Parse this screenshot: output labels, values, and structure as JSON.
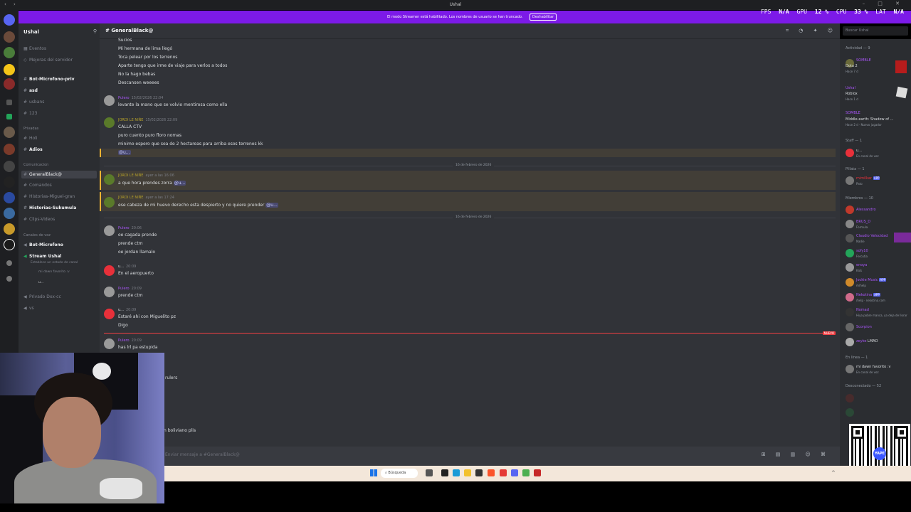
{
  "window": {
    "title": "Ushal"
  },
  "banner": {
    "message": "El modo Streamer está habilitado. Los nombres de usuario se han truncado.",
    "button": "Deshabilitar"
  },
  "perf": {
    "fps_label": "FPS",
    "fps": "N/A",
    "gpu_label": "GPU",
    "gpu": "12 %",
    "cpu_label": "CPU",
    "cpu": "33 %",
    "lat_label": "LAT",
    "lat": "N/A"
  },
  "server": {
    "name": "Ushal"
  },
  "sidebar": {
    "top": [
      "Eventos",
      "Mejoras del servidor"
    ],
    "channels_a": [
      "Bot-Microfono-priv",
      "asd",
      "usbans",
      "123"
    ],
    "cat_privadas": "Privadas",
    "privadas": [
      "Holi",
      "Adios"
    ],
    "cat_comunicacion": "Comunicacion",
    "comunicacion": [
      "GeneralBlack@",
      "Comandos",
      "Historias-Miguel-gran",
      "Historias-Sukumula",
      "Clips-Videos"
    ],
    "cat_voz": "Canales de voz",
    "voz": [
      "Bot-Microfono",
      "Stream Ushal"
    ],
    "voz_status": "Establece un estado de canal",
    "voz_users": [
      "mi dawn favorito :v",
      "u..."
    ],
    "extra": [
      "Privado Dxx-cc",
      "vs"
    ]
  },
  "chat": {
    "channel": "GeneralBlack@",
    "composer_placeholder": "Enviar mensaje a #GeneralBlack@",
    "top_lines": [
      "Sucios",
      "Mi hermana de lima llegó",
      "Toca pelear por los terrenos",
      "Aparte tengo que irme de viaje para verlos a todos",
      "No la hago bebas",
      "Descansen weeees"
    ],
    "msg1": {
      "user": "Pulero",
      "ts": "15/02/2026 22:04",
      "lines": [
        "levante la mano que se volvio mentirosa como ella"
      ]
    },
    "msg2": {
      "user": "JORDI LE NIÑE",
      "ts": "15/02/2026 22:09",
      "lines": [
        "CALLA CTV",
        "puro cuento puro floro nomas",
        "minimo espero que sea de 2 hectareas para arriba esos terrenos kk"
      ],
      "mention": "@u..."
    },
    "divider1": "16 de febrero de 2026",
    "msg3": {
      "user": "JORDI LE NIÑE",
      "ts": "ayer a las 16:06",
      "text": "a que hora prendes zorra",
      "mention": "@u..."
    },
    "msg4": {
      "user": "JORDI LE NIÑE",
      "ts": "ayer a las 17:24",
      "text": "ese cabeza de mi huevo derecho esta despierto y no quiere prender",
      "mention": "@u..."
    },
    "divider2": "16 de febrero de 2026",
    "msg5": {
      "user": "Pulero",
      "ts": "20:06",
      "lines": [
        "oe cagada prende",
        "prende ctm",
        "oe jordan llamalo"
      ]
    },
    "msg6": {
      "user": "u...",
      "ts": "20:09",
      "lines": [
        "En el aeropuerto"
      ]
    },
    "msg7": {
      "user": "Pulero",
      "ts": "20:09",
      "lines": [
        "prende ctm"
      ]
    },
    "msg8": {
      "user": "u...",
      "ts": "20:09",
      "lines": [
        "Estaré ahi con Miguelito pz",
        "Digo"
      ]
    },
    "new_label": "NUEVO",
    "msg9": {
      "user": "Pulero",
      "ts": "20:09",
      "lines": [
        "has lrl pa estupida"
      ]
    },
    "partial1": "rulers",
    "partial2": "n boliviano plis"
  },
  "members": {
    "activity_header": "Actividad — 9",
    "activities": [
      {
        "name": "SOMBLE",
        "game": "Dota 2",
        "detail": "Hace 7 d"
      },
      {
        "name": "Ushal",
        "game": "Roblox",
        "detail": "Hace 1 d"
      },
      {
        "name": "SOMBLE",
        "game": "Middle-earth: Shadow of ...",
        "detail": "Hace 2 d · Nuevo jugador"
      }
    ],
    "staff_header": "Staff — 1",
    "staff": [
      {
        "name": "u...",
        "status": "En canal de voz"
      }
    ],
    "pillata_header": "Pillata — 1",
    "pillata": [
      {
        "name": "mimilkar",
        "status": "Pato",
        "tag": "APP"
      }
    ],
    "miembros_header": "Miembros — 10",
    "miembros": [
      {
        "name": "Alessandro",
        "status": ""
      },
      {
        "name": "BRUS_D",
        "status": "Formula"
      },
      {
        "name": "Claudio Velocidad",
        "status": "Nadie"
      },
      {
        "name": "sofy10",
        "status": "Fercutia"
      },
      {
        "name": "enoya",
        "status": "Kick"
      },
      {
        "name": "Jockie Music",
        "status": "m/help",
        "tag": "APP"
      },
      {
        "name": "Nekotina",
        "status": "/help · nekotina.com",
        "tag": "APP"
      },
      {
        "name": "Nomad",
        "status": "Hiya pobre manca, ya deja de llorar"
      },
      {
        "name": "Scorpion",
        "status": ""
      },
      {
        "name": "zeyko",
        "status": "LMAO"
      }
    ],
    "enlinea_header": "En línea — 1",
    "enlinea": [
      {
        "name": "mi dawn favorito :v",
        "status": "En canal de voz"
      }
    ],
    "desconectado_header": "Desconectado — 52"
  },
  "search": {
    "placeholder": "Buscar Ushal"
  },
  "taskbar": {
    "search": "Búsqueda"
  },
  "qr": {
    "logo": "YAPE"
  }
}
